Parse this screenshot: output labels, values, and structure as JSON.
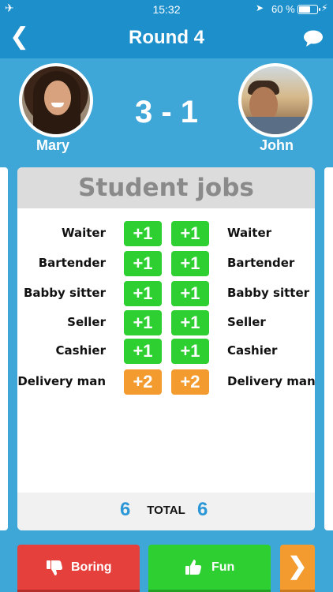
{
  "status_bar": {
    "time": "15:32",
    "battery_text": "60 %",
    "battery_level": 0.6,
    "icons": [
      "airplane-icon",
      "location-icon",
      "battery-icon",
      "charging-icon"
    ]
  },
  "nav": {
    "title": "Round 4",
    "back_glyph": "❮"
  },
  "players": {
    "left": {
      "name": "Mary"
    },
    "right": {
      "name": "John"
    }
  },
  "score": "3 - 1",
  "card": {
    "title": "Student jobs",
    "rows": [
      {
        "left_label": "Waiter",
        "left_points": "+1",
        "right_points": "+1",
        "right_label": "Waiter",
        "color": "green"
      },
      {
        "left_label": "Bartender",
        "left_points": "+1",
        "right_points": "+1",
        "right_label": "Bartender",
        "color": "green"
      },
      {
        "left_label": "Babby sitter",
        "left_points": "+1",
        "right_points": "+1",
        "right_label": "Babby sitter",
        "color": "green"
      },
      {
        "left_label": "Seller",
        "left_points": "+1",
        "right_points": "+1",
        "right_label": "Seller",
        "color": "green"
      },
      {
        "left_label": "Cashier",
        "left_points": "+1",
        "right_points": "+1",
        "right_label": "Cashier",
        "color": "green"
      },
      {
        "left_label": "Delivery man",
        "left_points": "+2",
        "right_points": "+2",
        "right_label": "Delivery man",
        "color": "orange"
      }
    ],
    "total": {
      "left": "6",
      "label": "TOTAL",
      "right": "6"
    }
  },
  "buttons": {
    "boring": "Boring",
    "fun": "Fun",
    "next_glyph": "❯"
  },
  "colors": {
    "background": "#3ea7d8",
    "nav": "#1d8fcb",
    "green": "#2ecf31",
    "orange": "#f39b2f",
    "red": "#e6403c",
    "total_number": "#2b97d6"
  }
}
